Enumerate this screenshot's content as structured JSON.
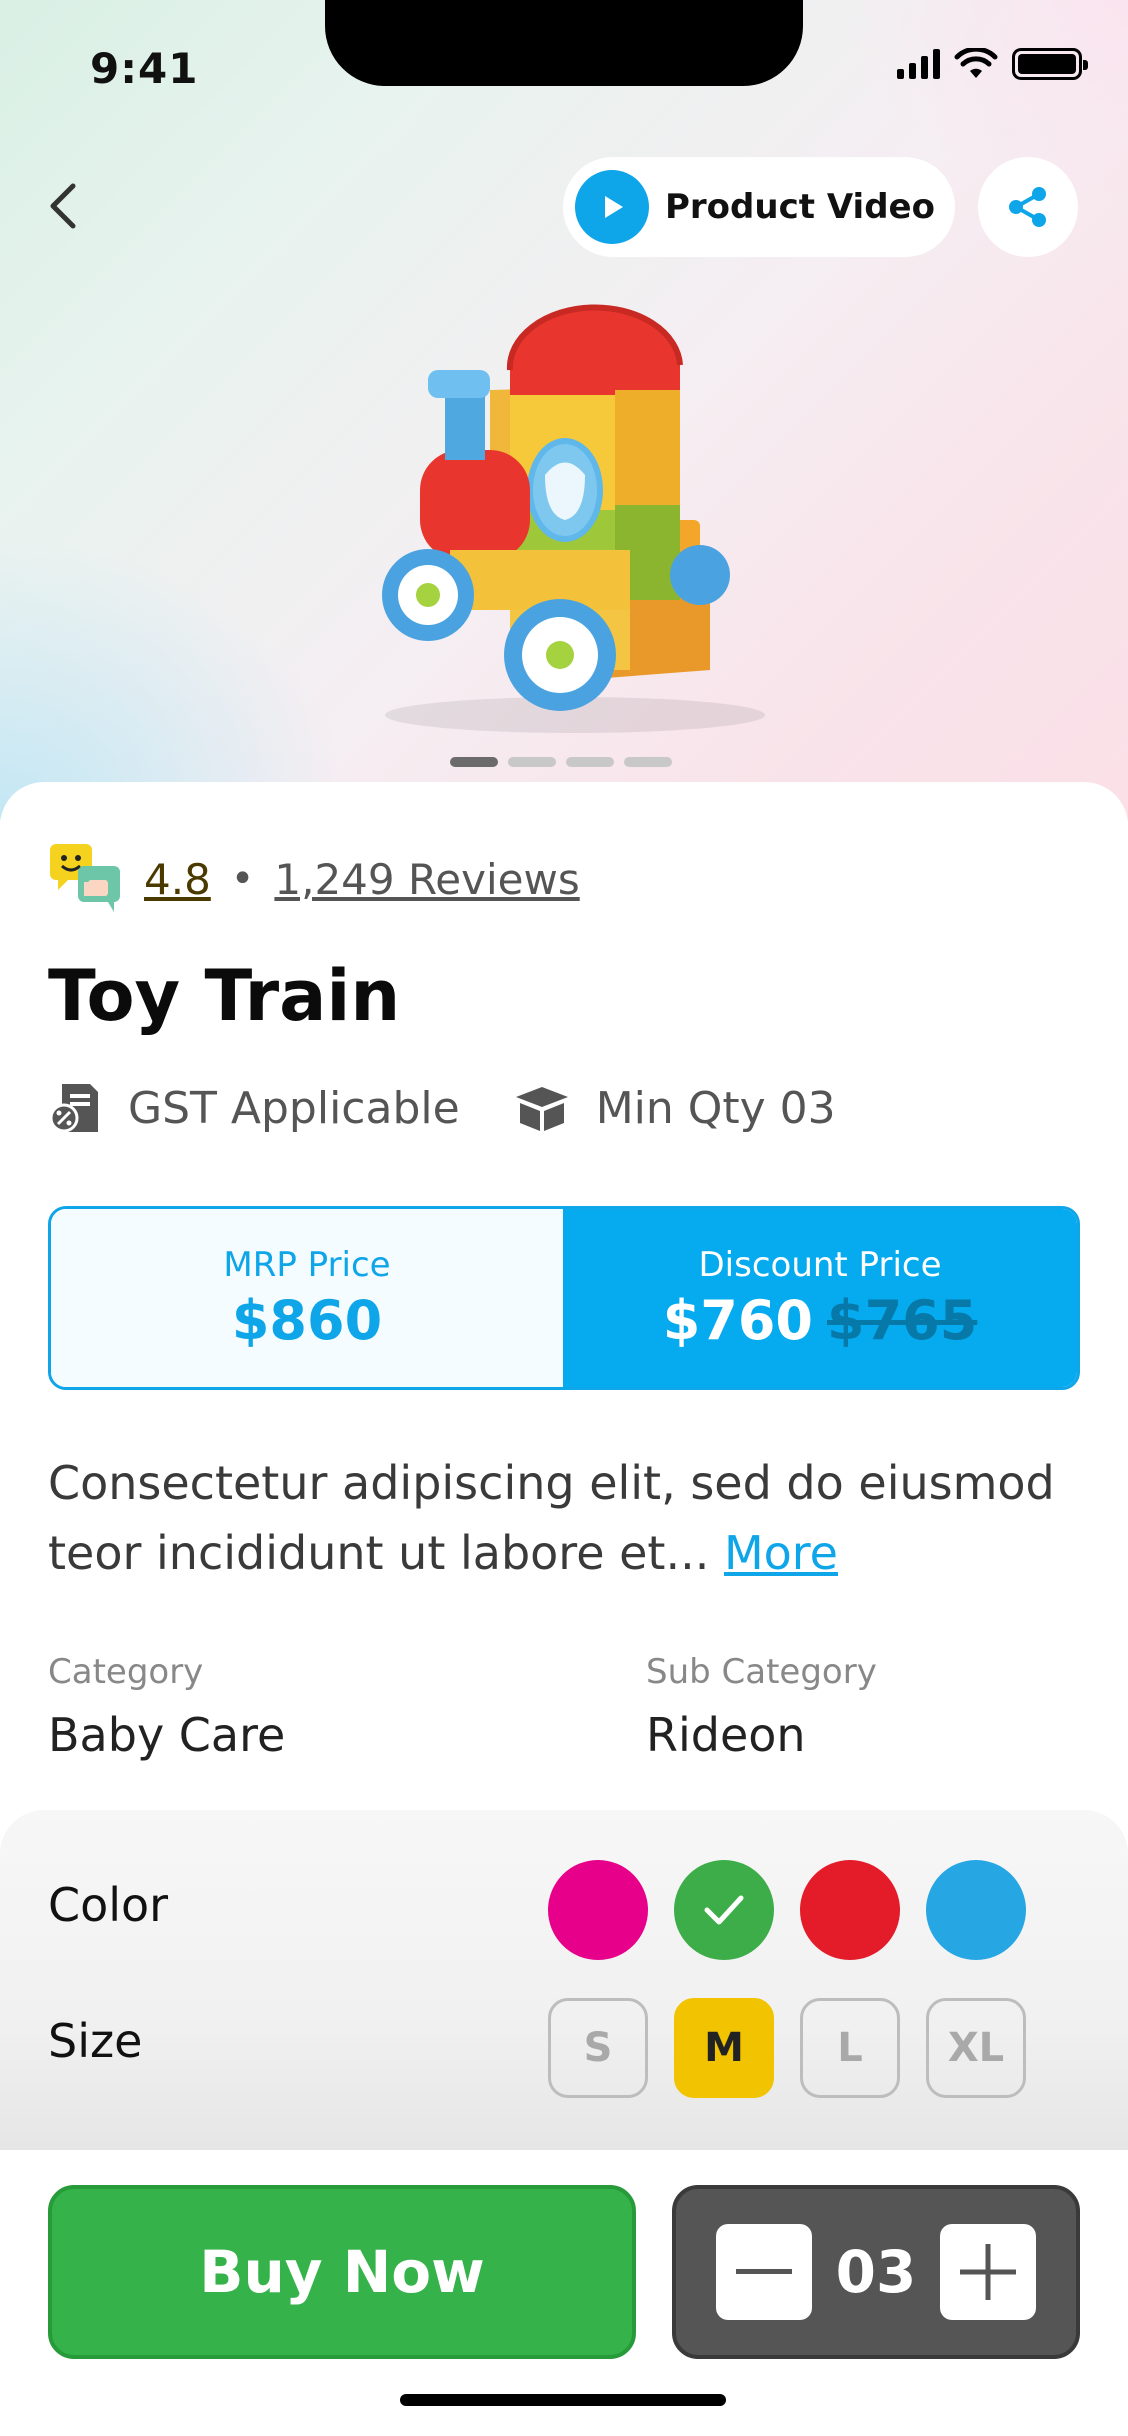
{
  "status_bar": {
    "time": "9:41"
  },
  "header": {
    "video_label": "Product Video"
  },
  "product": {
    "rating": "4.8",
    "separator": "•",
    "reviews": "1,249 Reviews",
    "title": "Toy Train",
    "gst": "GST Applicable",
    "min_qty": "Min Qty 03",
    "mrp_label": "MRP Price",
    "mrp_value": "$860",
    "discount_label": "Discount Price",
    "discount_value": "$760",
    "old_value": "$765",
    "description": "Consectetur adipiscing elit, sed do eiusmod teor incididunt ut labore et...",
    "more_label": "More",
    "category_label": "Category",
    "category_value": "Baby Care",
    "subcategory_label": "Sub Category",
    "subcategory_value": "Rideon"
  },
  "options": {
    "color_label": "Color",
    "colors": [
      "#e6008a",
      "#3cad48",
      "#e41c2a",
      "#27a6e4"
    ],
    "selected_color_index": 1,
    "size_label": "Size",
    "sizes": [
      "S",
      "M",
      "L",
      "XL"
    ],
    "selected_size": "M"
  },
  "cart": {
    "buy_label": "Buy Now",
    "quantity": "03"
  },
  "carousel": {
    "pages": 4,
    "active": 0
  },
  "colors": {
    "accent": "#0ea5e9",
    "buy": "#35b34a",
    "size_selected": "#f2c300"
  }
}
